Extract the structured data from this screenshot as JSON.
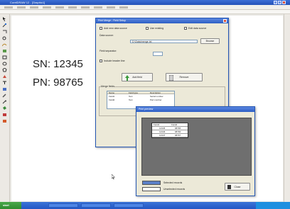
{
  "app": {
    "title": "CorelDRAW 12 - [Graphic1]",
    "colors": {
      "titlebar": "#2d5fc4",
      "canvas": "#ffffff",
      "dialog": "#ece9d8",
      "preview_area": "#6f6f6f",
      "swatch_blue": "#5b7fc8"
    }
  },
  "canvas": {
    "sn_text": "SN: 12345",
    "pn_text": "PN: 98765"
  },
  "dialog": {
    "title": "Print Merge - Field Setup",
    "options": {
      "opt1": "Add new data source",
      "opt2": "Use existing",
      "opt3": "Edit data source"
    },
    "source_label": "Data source:",
    "source_value": "D:\\Data\\merge.txt",
    "browse_label": "Browse",
    "field_label": "Field separator:",
    "include_label": "Include header line",
    "add_label": "Add field",
    "delete_label": "Remove",
    "fields_group_label": "Merge fields",
    "table_headers": [
      "Name",
      "Field type",
      "Description"
    ],
    "table_rows": [
      [
        "Field1",
        "Text",
        "Serial number"
      ],
      [
        "Field2",
        "Text",
        "Part number"
      ]
    ]
  },
  "preview": {
    "title": "Print preview",
    "table_headers": [
      "Field1",
      "Field2"
    ],
    "table_rows": [
      [
        "12345",
        "98765"
      ],
      [
        "12346",
        "98766"
      ],
      [
        "12347",
        "98767"
      ]
    ],
    "legend_selected": "Selected records",
    "legend_other": "Unselected records",
    "close_label": "Close"
  },
  "taskbar": {
    "start_label": "start"
  }
}
